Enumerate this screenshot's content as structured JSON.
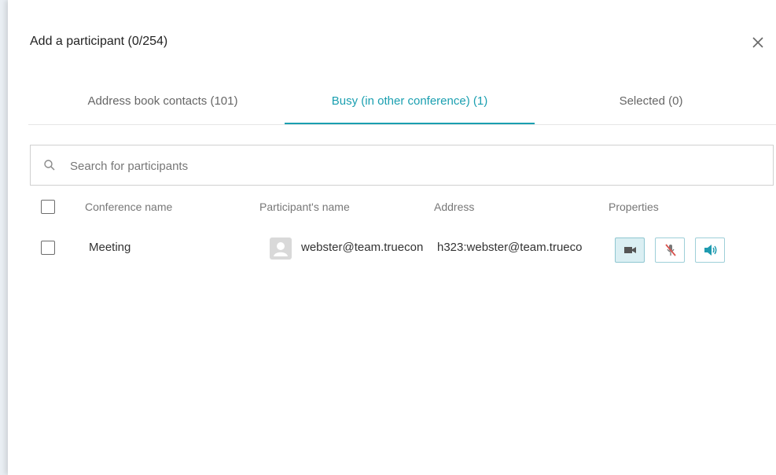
{
  "dialog": {
    "title": "Add a participant (0/254)"
  },
  "tabs": [
    {
      "label": "Address book contacts (101)",
      "active": false
    },
    {
      "label": "Busy (in other conference) (1)",
      "active": true
    },
    {
      "label": "Selected (0)",
      "active": false
    }
  ],
  "search": {
    "placeholder": "Search for participants",
    "value": ""
  },
  "table": {
    "columns": [
      "Conference name",
      "Participant's name",
      "Address",
      "Properties"
    ],
    "rows": [
      {
        "conference_name": "Meeting",
        "participant_name": "webster@team.truecon",
        "address": "h323:webster@team.trueco",
        "properties": [
          "camera-off-icon",
          "microphone-off-icon",
          "speaker-on-icon"
        ]
      }
    ]
  },
  "colors": {
    "accent": "#1a9fb0",
    "mute_red": "#d9534f",
    "icon_teal": "#1f9bb0"
  }
}
